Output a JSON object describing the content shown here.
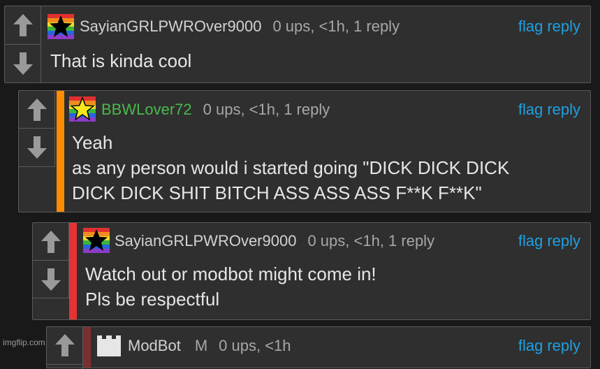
{
  "comments": [
    {
      "username": "SayianGRLPWROver9000",
      "meta": "0 ups, <1h, 1 reply",
      "flag_label": "flag",
      "reply_label": "reply",
      "body_lines": [
        "That is kinda cool"
      ],
      "avatar": "rainbow-black-star-icon"
    },
    {
      "username": "BBWLover72",
      "meta": "0 ups, <1h, 1 reply",
      "flag_label": "flag",
      "reply_label": "reply",
      "body_lines": [
        "Yeah",
        "as any person would i started going \"DICK DICK DICK",
        "DICK DICK SHIT BITCH ASS ASS ASS F**K F**K\""
      ],
      "avatar": "rainbow-yellow-star-icon",
      "accent_color": "#ff8c00",
      "username_color": "#4cb84c"
    },
    {
      "username": "SayianGRLPWROver9000",
      "meta": "0 ups, <1h, 1 reply",
      "flag_label": "flag",
      "reply_label": "reply",
      "body_lines": [
        "Watch out or modbot might come in!",
        "Pls be respectful"
      ],
      "avatar": "rainbow-black-star-icon",
      "accent_color": "#e63232"
    },
    {
      "username": "ModBot",
      "badge": "M",
      "meta": "0 ups, <1h",
      "flag_label": "flag",
      "reply_label": "reply",
      "avatar": "castle-icon",
      "accent_color": "#7a3030"
    }
  ],
  "watermark": "imgflip.com"
}
